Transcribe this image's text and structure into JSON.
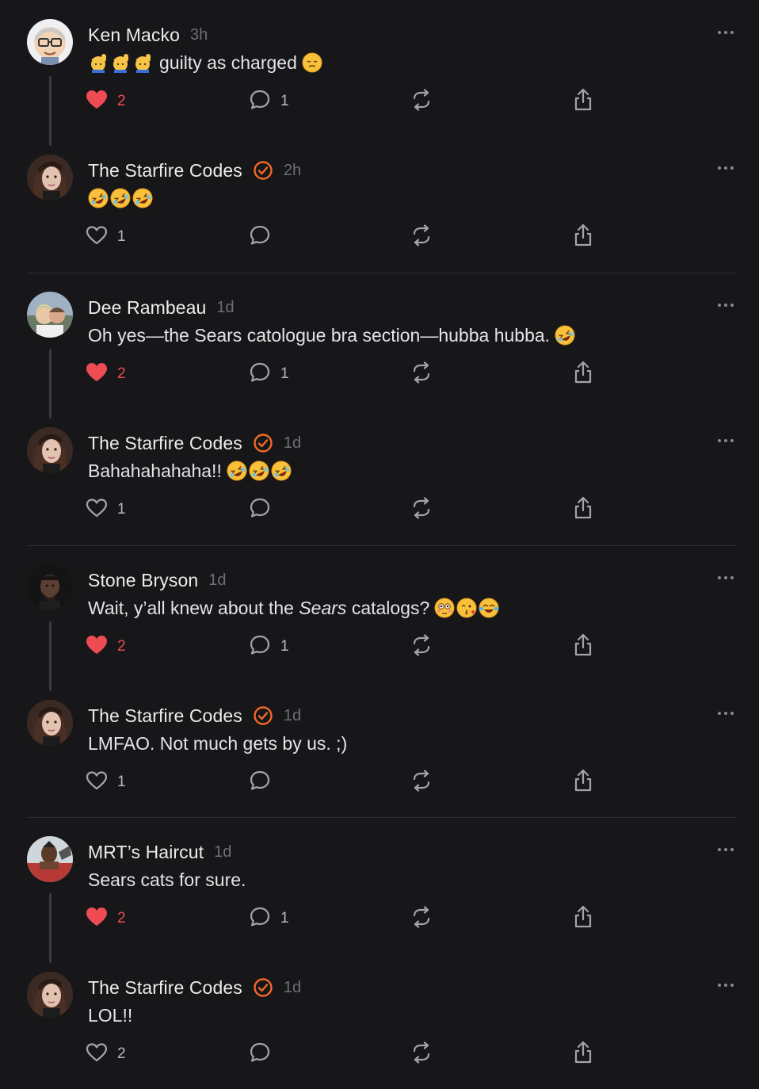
{
  "colors": {
    "background": "#17171a",
    "accent_orange": "#f26a22",
    "like_red": "#ee4b55",
    "icon_gray": "#a4a4a8",
    "muted_text": "#6f6f74"
  },
  "comments": [
    {
      "author": "Ken Macko",
      "timestamp": "3h",
      "verified": false,
      "lead_emojis": [
        "raising-hand-emoji",
        "raising-hand-emoji",
        "raising-hand-emoji"
      ],
      "text": "guilty as charged",
      "trail_emojis": [
        "pensive-face-emoji"
      ],
      "liked": true,
      "like_count": "2",
      "reply_count": "1",
      "has_thread_line": true,
      "avatar": "cartoon-glasses"
    },
    {
      "author": "The Starfire Codes",
      "timestamp": "2h",
      "verified": true,
      "lead_emojis": [],
      "text": "",
      "trail_emojis": [
        "rofl-emoji",
        "rofl-emoji",
        "rofl-emoji"
      ],
      "liked": false,
      "like_count": "1",
      "reply_count": "",
      "has_thread_line": false,
      "avatar": "woman-portrait"
    },
    {
      "author": "Dee Rambeau",
      "timestamp": "1d",
      "verified": false,
      "lead_emojis": [],
      "text": "Oh yes—the Sears catologue bra section—hubba hubba.",
      "trail_emojis": [
        "rofl-emoji"
      ],
      "liked": true,
      "like_count": "2",
      "reply_count": "1",
      "has_thread_line": true,
      "avatar": "couple-photo"
    },
    {
      "author": "The Starfire Codes",
      "timestamp": "1d",
      "verified": true,
      "lead_emojis": [],
      "text": "Bahahahahaha!!",
      "trail_emojis": [
        "rofl-emoji",
        "rofl-emoji",
        "rofl-emoji"
      ],
      "liked": false,
      "like_count": "1",
      "reply_count": "",
      "has_thread_line": false,
      "avatar": "woman-portrait"
    },
    {
      "author": "Stone Bryson",
      "timestamp": "1d",
      "verified": false,
      "lead_emojis": [],
      "text_before": "Wait, y’all knew about the ",
      "text_italic": "Sears",
      "text_after": " catalogs?",
      "trail_emojis": [
        "flushed-face-emoji",
        "winking-kiss-emoji",
        "tears-of-joy-emoji"
      ],
      "liked": true,
      "like_count": "2",
      "reply_count": "1",
      "has_thread_line": true,
      "avatar": "dark-portrait"
    },
    {
      "author": "The Starfire Codes",
      "timestamp": "1d",
      "verified": true,
      "lead_emojis": [],
      "text": "LMFAO. Not much gets by us. ;)",
      "trail_emojis": [],
      "liked": false,
      "like_count": "1",
      "reply_count": "",
      "has_thread_line": false,
      "avatar": "woman-portrait"
    },
    {
      "author": "MRT’s Haircut",
      "timestamp": "1d",
      "verified": false,
      "lead_emojis": [],
      "text": "Sears cats for sure.",
      "trail_emojis": [],
      "liked": true,
      "like_count": "2",
      "reply_count": "1",
      "has_thread_line": true,
      "avatar": "man-red-shirt"
    },
    {
      "author": "The Starfire Codes",
      "timestamp": "1d",
      "verified": true,
      "lead_emojis": [],
      "text": "LOL!!",
      "trail_emojis": [],
      "liked": false,
      "like_count": "2",
      "reply_count": "",
      "has_thread_line": false,
      "avatar": "woman-portrait"
    }
  ]
}
